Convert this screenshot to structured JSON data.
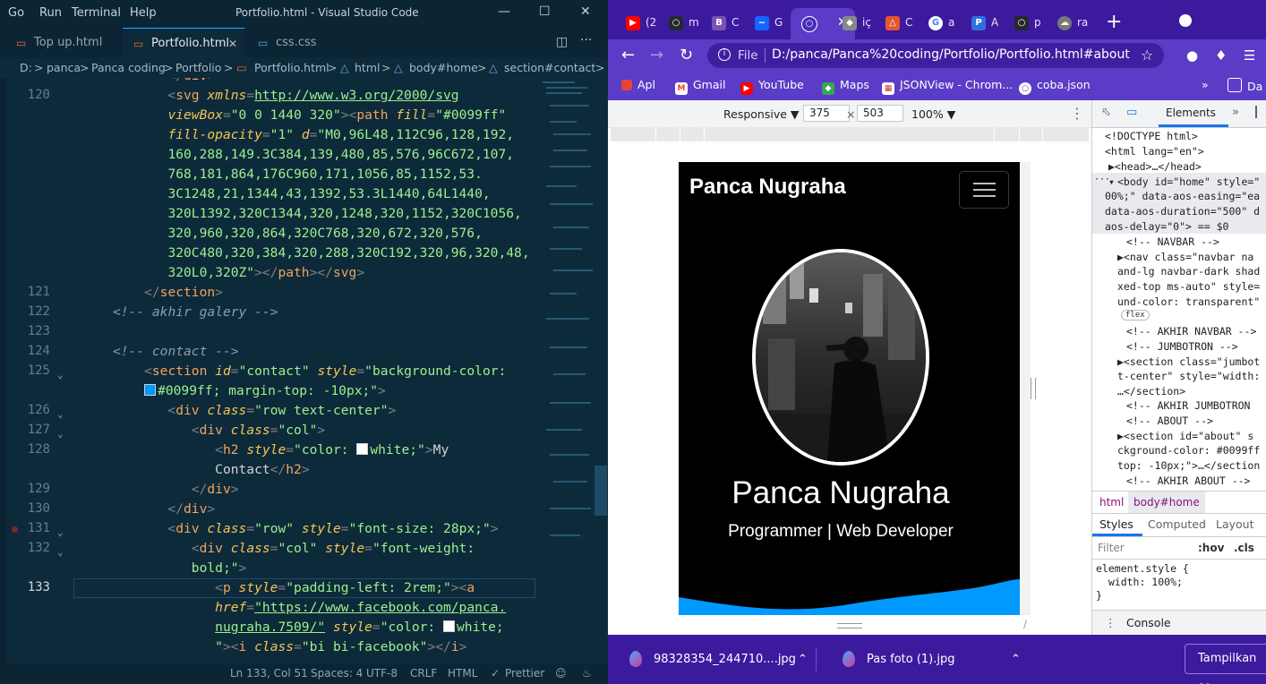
{
  "vscode": {
    "menu": [
      "Go",
      "Run",
      "Terminal",
      "Help"
    ],
    "title": "Portfolio.html - Visual Studio Code",
    "tabs": [
      {
        "label": "Top up.html",
        "icon": "html"
      },
      {
        "label": "Portfolio.html",
        "icon": "html",
        "active": true
      },
      {
        "label": "css.css",
        "icon": "css"
      }
    ],
    "breadcrumb": [
      "D:",
      ">",
      "panca",
      ">",
      "Panca coding",
      ">",
      "Portfolio",
      ">",
      "Portfolio.html",
      ">",
      "html",
      ">",
      "body#home",
      ">",
      "section#contact",
      ">"
    ],
    "line_numbers": {
      "l120": "120",
      "l121": "121",
      "l122": "122",
      "l123": "123",
      "l124": "124",
      "l125": "125",
      "l126": "126",
      "l127": "127",
      "l128": "128",
      "l129": "129",
      "l130": "130",
      "l131": "131",
      "l132": "132",
      "l133": "133"
    },
    "code": {
      "svg_url": "http://www.w3.org/2000/svg",
      "viewbox": "\"0 0 1440 320\"",
      "fill": "\"#0099ff\"",
      "fill_opacity": "\"1\"",
      "d1": "\"M0,96L48,112C96,128,192,",
      "d2": "160,288,149.3C384,139,480,85,576,96C672,107,",
      "d3": "768,181,864,176C960,171,1056,85,1152,53.",
      "d4": "3C1248,21,1344,43,1392,53.3L1440,64L1440,",
      "d5": "320L1392,320C1344,320,1248,320,1152,320C1056,",
      "d6": "320,960,320,864,320C768,320,672,320,576,",
      "d7": "320C480,320,384,320,288,320C192,320,96,320,48,",
      "d8": "320L0,320Z\"",
      "c_galery": "<!-- akhir galery -->",
      "c_contact": "<!-- contact -->",
      "contact_id": "\"contact\"",
      "contact_style1": "\"background-color:",
      "contact_style2": "#0099ff; margin-top: -10px;\"",
      "row_tc": "\"row text-center\"",
      "col": "\"col\"",
      "h2_style": "\"color: ",
      "h2_white": "white;\"",
      "h2_text1": "My",
      "h2_text2": "Contact",
      "row_style": "\"font-size: 28px;\"",
      "row": "\"row\"",
      "col_style1": "\"font-weight:",
      "col_style2": "bold;\"",
      "p_style": "\"padding-left: 2rem;\"",
      "fb_url1": "\"https://www.facebook.com/panca.",
      "fb_url2": "nugraha.7509/\"",
      "a_style": "\"color: ",
      "a_white": "white;",
      "a_style_end": "\"",
      "i_class": "\"bi bi-facebook\""
    },
    "status": {
      "position": "Ln 133, Col 51",
      "spaces": "Spaces: 4",
      "encoding": "UTF-8",
      "eol": "CRLF",
      "language": "HTML",
      "formatter": "Prettier"
    }
  },
  "chrome": {
    "tabs": [
      {
        "icon": "youtube",
        "label": "(2"
      },
      {
        "icon": "github",
        "label": "m"
      },
      {
        "icon": "bootstrap",
        "label": "C"
      },
      {
        "icon": "wave",
        "label": "G"
      },
      {
        "icon": "globe",
        "label": "",
        "active": true
      },
      {
        "icon": "git",
        "label": "iç"
      },
      {
        "icon": "codepen",
        "label": "C"
      },
      {
        "icon": "google",
        "label": "a"
      },
      {
        "icon": "p-app",
        "label": "A"
      },
      {
        "icon": "github",
        "label": "p"
      },
      {
        "icon": "cloud",
        "label": "ra"
      }
    ],
    "address": {
      "scheme": "File",
      "url": "D:/panca/Panca%20coding/Portfolio/Portfolio.html#about"
    },
    "bookmarks": [
      "Apl",
      "Gmail",
      "YouTube",
      "Maps",
      "JSONView - Chrom...",
      "coba.json"
    ],
    "bookmarks_more": "»",
    "bookmarks_da": "Da",
    "device_toolbar": {
      "mode": "Responsive ▼",
      "width": "375",
      "height": "503",
      "x": "×",
      "zoom": "100% ▼"
    },
    "page": {
      "brand": "Panca Nugraha",
      "name": "Panca Nugraha",
      "role": "Programmer | Web Developer",
      "accent": "#0099ff"
    },
    "devtools": {
      "tab": "Elements",
      "dom": {
        "doctype": "<!DOCTYPE html>",
        "html_open": "<html lang=\"en\">",
        "head": "▶<head>…</head>",
        "body1": "<body id=\"home\" style=\"",
        "body2": "00%;\" data-aos-easing=\"ea",
        "body3": "data-aos-duration=\"500\" d",
        "body4": "aos-delay=\"0\"> == $0",
        "c_navbar": "<!-- NAVBAR -->",
        "nav1": "▶<nav class=\"navbar na",
        "nav2": "and-lg navbar-dark shad",
        "nav3": "xed-top ms-auto\" style=",
        "nav4": "und-color: transparent\"",
        "flex": "flex",
        "c_akhir_navbar": "<!-- AKHIR NAVBAR -->",
        "c_jumbotron": "<!-- JUMBOTRON -->",
        "sec1": "▶<section class=\"jumbot",
        "sec2": "t-center\" style=\"width:",
        "sec3": "…</section>",
        "c_akhir_jumbotron": "<!-- AKHIR JUMBOTRON",
        "c_about": "<!-- ABOUT -->",
        "about1": "▶<section id=\"about\" s",
        "about2": "ckground-color: #0099ff",
        "about3": "top: -10px;\">…</section",
        "c_akhir_about": "<!-- AKHIR ABOUT -->"
      },
      "crumbs": [
        "html",
        "body#home"
      ],
      "subtabs": [
        "Styles",
        "Computed",
        "Layout"
      ],
      "filter_placeholder": "Filter",
      "filter_hov": ":hov",
      "filter_cls": ".cls",
      "style_rule": "element.style {\n  width: 100%;\n}",
      "console": "Console"
    },
    "downloads": [
      {
        "name": "98328354_244710....jpg"
      },
      {
        "name": "Pas foto (1).jpg"
      }
    ],
    "show_all": "Tampilkan se"
  }
}
